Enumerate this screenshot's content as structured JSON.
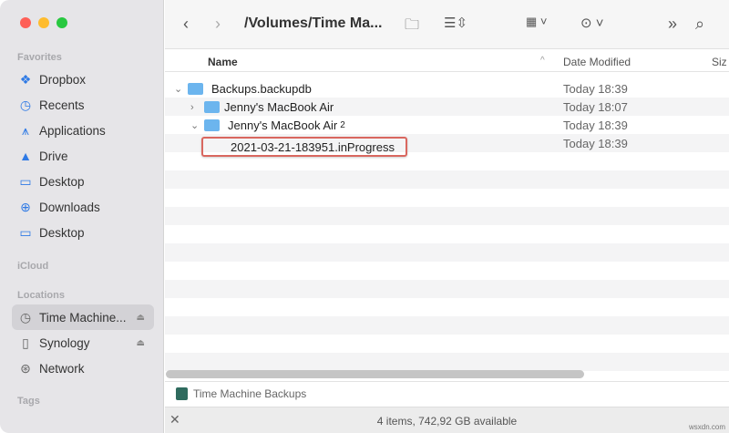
{
  "window": {
    "title": "/Volumes/Time Ma..."
  },
  "sidebar": {
    "favorites_label": "Favorites",
    "favorites": [
      {
        "label": "Dropbox",
        "icon": "dropbox-icon"
      },
      {
        "label": "Recents",
        "icon": "clock-icon"
      },
      {
        "label": "Applications",
        "icon": "applications-icon"
      },
      {
        "label": "Drive",
        "icon": "google-drive-icon"
      },
      {
        "label": "Desktop",
        "icon": "desktop-icon"
      },
      {
        "label": "Downloads",
        "icon": "download-icon"
      },
      {
        "label": "Desktop",
        "icon": "folder-icon"
      }
    ],
    "icloud_label": "iCloud",
    "locations_label": "Locations",
    "locations": [
      {
        "label": "Time Machine...",
        "icon": "time-machine-icon"
      },
      {
        "label": "Synology",
        "icon": "document-icon"
      },
      {
        "label": "Network",
        "icon": "network-icon"
      }
    ],
    "tags_label": "Tags"
  },
  "columns": {
    "name": "Name",
    "date": "Date Modified",
    "size": "Siz"
  },
  "rows": [
    {
      "name": "Backups.backupdb",
      "date": "Today 18:39"
    },
    {
      "name": "Jenny's MacBook Air",
      "date": "Today 18:07"
    },
    {
      "name": "Jenny's MacBook Air",
      "suffix": "2",
      "date": "Today 18:39"
    },
    {
      "name": "2021-03-21-183951.inProgress",
      "date": "Today 18:39"
    }
  ],
  "pathbar": {
    "label": "Time Machine Backups"
  },
  "status": {
    "text": "4 items, 742,92 GB available"
  },
  "watermark": "wsxdn.com",
  "colors": {
    "accent": "#2f7ae5",
    "highlight_border": "#d9675f",
    "folder": "#6cb5ee"
  }
}
